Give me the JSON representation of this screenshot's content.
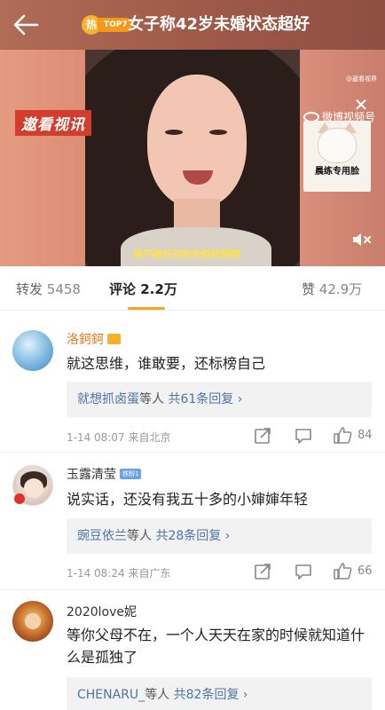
{
  "header": {
    "hot_icon_label": "热",
    "hot_rank": "TOP7",
    "title": "女子称42岁未婚状态超好"
  },
  "video": {
    "brand_left": "遨看视讯",
    "brand_right": "微博视频号",
    "brand_right_sub": "@遨看视界",
    "sticker_text": "晨练专用脸",
    "subtitle": "我不被任何的世俗所绑架"
  },
  "tabs": [
    {
      "label": "转发",
      "count": "5458"
    },
    {
      "label": "评论",
      "count": "2.2万"
    },
    {
      "label": "赞",
      "count": "42.9万"
    }
  ],
  "comments": [
    {
      "username": "洛鈳鈳",
      "text": "就这思维，谁敢要，还标榜自己",
      "reply_user": "就想抓卤蛋",
      "reply_suffix": "等人",
      "reply_total": "共61条回复",
      "time": "1-14 08:07",
      "location": "来自北京",
      "likes": "84"
    },
    {
      "username": "玉露清莹",
      "badge": "铁粉1",
      "text": "说实话，还没有我五十多的小婶婶年轻",
      "reply_user": "豌豆依兰",
      "reply_suffix": "等人",
      "reply_total": "共28条回复",
      "time": "1-14 08:24",
      "location": "来自广东",
      "likes": "66"
    },
    {
      "username": "2020love妮",
      "text": "等你父母不在，一个人天天在家的时候就知道什么是孤独了",
      "reply_user": "CHENARU_",
      "reply_suffix": "等人",
      "reply_total": "共82条回复"
    }
  ],
  "colors": {
    "accent": "#f7a51c",
    "link": "#4c74a8",
    "username_orange": "#e8761b"
  }
}
